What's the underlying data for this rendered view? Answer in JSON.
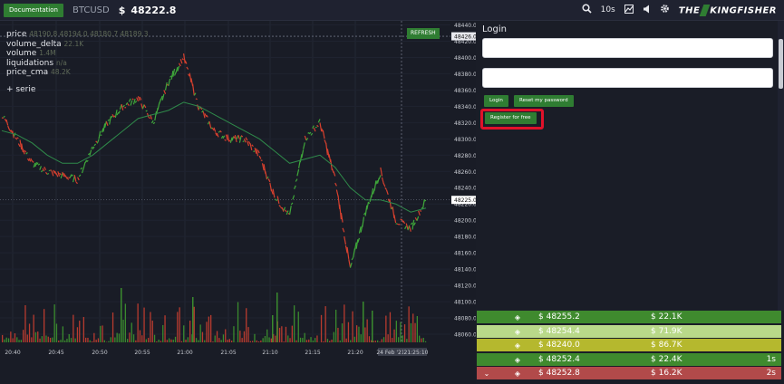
{
  "topbar": {
    "doc_label": "Documentation",
    "pair": "BTCUSD",
    "dollar": "$",
    "price": "48222.8",
    "timeframe": "10s",
    "icons": [
      "search-icon",
      "image-icon",
      "volume-icon",
      "gear-icon"
    ],
    "brand_prefix": "THE",
    "brand_suffix": "KINGFISHER"
  },
  "chart": {
    "legend": [
      {
        "name": "price",
        "value": "48190.8 48194.0 48180.7 48189.3"
      },
      {
        "name": "volume_delta",
        "value": "22.1K"
      },
      {
        "name": "volume",
        "value": "1.4M"
      },
      {
        "name": "liquidations",
        "value": "n/a"
      },
      {
        "name": "price_cma",
        "value": "48.2K"
      }
    ],
    "add_serie": "+ serie",
    "refresh_label": "REFRESH",
    "price_ticks": [
      "48440.0",
      "48420.0",
      "48400.0",
      "48380.0",
      "48360.0",
      "48340.0",
      "48320.0",
      "48300.0",
      "48280.0",
      "48260.0",
      "48240.0",
      "48220.0",
      "48200.0",
      "48180.0",
      "48160.0",
      "48140.0",
      "48120.0",
      "48100.0",
      "48080.0",
      "48060.0"
    ],
    "time_ticks": [
      "20:40",
      "20:45",
      "20:50",
      "20:55",
      "21:00",
      "21:05",
      "21:10",
      "21:15",
      "21:20",
      "24 Feb '21",
      "21:25:10"
    ],
    "crosshair_price": "48426.0",
    "last_price_label": "48225.0"
  },
  "chart_data": {
    "type": "line",
    "title": "",
    "xlabel": "",
    "ylabel": "",
    "ylim": [
      48050,
      48445
    ],
    "x": [
      "20:38",
      "20:40",
      "20:42",
      "20:44",
      "20:46",
      "20:48",
      "20:50",
      "20:52",
      "20:54",
      "20:56",
      "20:58",
      "21:00",
      "21:01",
      "21:02",
      "21:04",
      "21:06",
      "21:08",
      "21:10",
      "21:12",
      "21:13",
      "21:14",
      "21:15",
      "21:16",
      "21:18",
      "21:20",
      "21:22",
      "21:23",
      "21:24",
      "21:25"
    ],
    "series": [
      {
        "name": "price",
        "values": [
          48330,
          48300,
          48270,
          48260,
          48255,
          48250,
          48290,
          48320,
          48340,
          48350,
          48320,
          48370,
          48400,
          48340,
          48310,
          48300,
          48300,
          48280,
          48230,
          48205,
          48300,
          48320,
          48250,
          48140,
          48210,
          48260,
          48200,
          48190,
          48225
        ]
      },
      {
        "name": "price_cma",
        "values": [
          48310,
          48305,
          48295,
          48280,
          48270,
          48270,
          48280,
          48295,
          48310,
          48325,
          48330,
          48335,
          48345,
          48340,
          48330,
          48320,
          48310,
          48300,
          48285,
          48270,
          48275,
          48280,
          48265,
          48240,
          48225,
          48225,
          48220,
          48210,
          48215
        ]
      }
    ]
  },
  "login": {
    "title": "Login",
    "username_value": "",
    "password_value": "",
    "login_label": "Login",
    "reset_label": "Reset my password",
    "register_label": "Register for free"
  },
  "trades": [
    {
      "side": "up",
      "price": "$ 48255.2",
      "amount": "$ 22.1K",
      "time": "",
      "color": "#3f8a2e"
    },
    {
      "side": "up",
      "price": "$ 48254.4",
      "amount": "$ 71.9K",
      "time": "",
      "color": "#b9d98a"
    },
    {
      "side": "up",
      "price": "$ 48240.0",
      "amount": "$ 86.7K",
      "time": "",
      "color": "#b5b82e"
    },
    {
      "side": "up",
      "price": "$ 48252.4",
      "amount": "$ 22.4K",
      "time": "1s",
      "color": "#3f8a2e"
    },
    {
      "side": "down",
      "price": "$ 48252.8",
      "amount": "$ 16.2K",
      "time": "2s",
      "color": "#b24a4a"
    }
  ]
}
